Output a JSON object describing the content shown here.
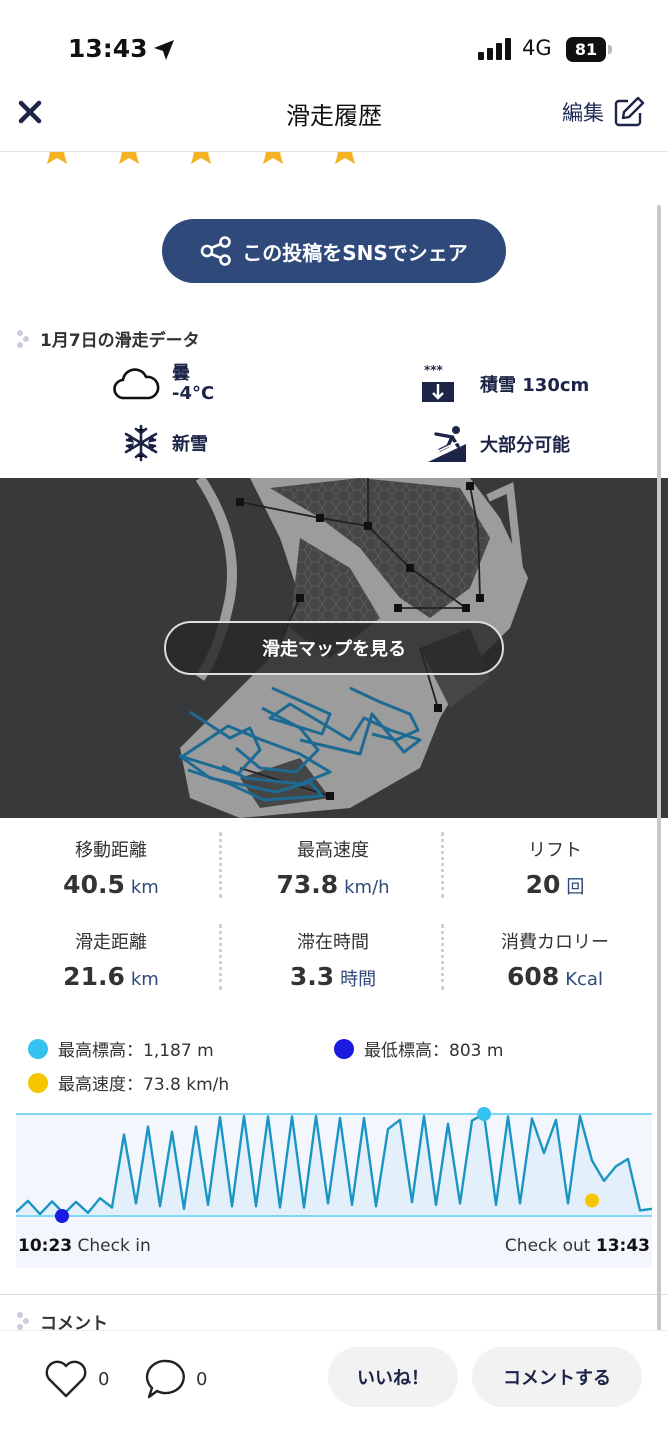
{
  "status_bar": {
    "time": "13:43",
    "network": "4G",
    "battery": "81"
  },
  "nav": {
    "title": "滑走履歴",
    "edit_label": "編集"
  },
  "rating": {
    "stars": 5
  },
  "share": {
    "label": "この投稿をSNSでシェア"
  },
  "day_section": {
    "label": "1月7日の滑走データ",
    "weather": {
      "condition": "曇",
      "temperature": "-4°C"
    },
    "snow_depth": "積雪 130cm",
    "snow_type": "新雪",
    "course_status": "大部分可能"
  },
  "map": {
    "button_label": "滑走マップを見る"
  },
  "stats": [
    {
      "label": "移動距離",
      "value": "40.5",
      "unit": "km"
    },
    {
      "label": "最高速度",
      "value": "73.8",
      "unit": "km/h"
    },
    {
      "label": "リフト",
      "value": "20",
      "unit": "回"
    },
    {
      "label": "滑走距離",
      "value": "21.6",
      "unit": "km"
    },
    {
      "label": "滞在時間",
      "value": "3.3",
      "unit": "時間"
    },
    {
      "label": "消費カロリー",
      "value": "608",
      "unit": "Kcal"
    }
  ],
  "legend": {
    "max_alt": "最高標高：1,187 m",
    "min_alt": "最低標高：803 m",
    "max_speed": "最高速度：73.8 km/h"
  },
  "timeline": {
    "check_in_time": "10:23",
    "check_in_label": "Check in",
    "check_out_label": "Check out",
    "check_out_time": "13:43"
  },
  "comments": {
    "label": "コメント",
    "like_count": "0",
    "comment_count": "0"
  },
  "actions": {
    "like_label": "いいね！",
    "comment_label": "コメントする"
  },
  "colors": {
    "accent_navy": "#2f4a7a",
    "line_blue": "#1b95c2",
    "max_alt_dot": "#35c2f0",
    "min_alt_dot": "#1a1ae0",
    "max_speed_dot": "#f7c600",
    "track_blue": "#1d6a93"
  },
  "chart_data": {
    "type": "line",
    "title": "",
    "xlabel": "",
    "ylabel": "",
    "x_start": "10:23",
    "x_end": "13:43",
    "ylim": [
      803,
      1187
    ],
    "y_unit": "m",
    "series": [
      {
        "values": [
          818,
          860,
          810,
          858,
          812,
          856,
          815,
          870,
          835,
          1110,
          850,
          1140,
          840,
          1120,
          830,
          1140,
          845,
          1175,
          840,
          1180,
          840,
          1178,
          835,
          1178,
          835,
          1180,
          850,
          1172,
          845,
          1172,
          840,
          1130,
          1165,
          855,
          1180,
          845,
          1150,
          850,
          1162,
          1187,
          845,
          1178,
          850,
          1170,
          1040,
          1165,
          850,
          1180,
          1012,
          935,
          990,
          1018,
          824,
          830
        ]
      }
    ],
    "markers": [
      {
        "label": "最高標高",
        "value": 1187
      },
      {
        "label": "最低標高",
        "value": 803
      },
      {
        "label": "最高速度",
        "value": "73.8 km/h"
      }
    ]
  }
}
